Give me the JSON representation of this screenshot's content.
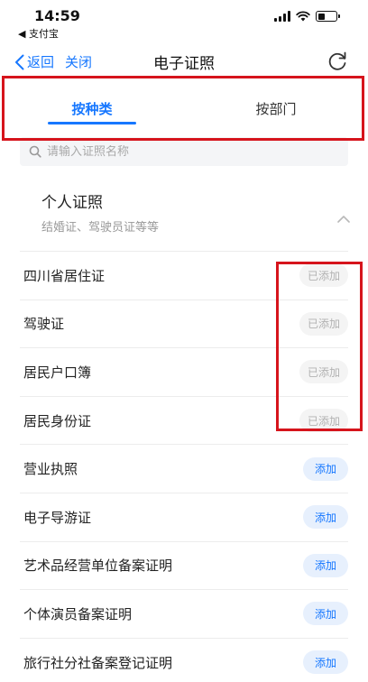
{
  "status_bar": {
    "time": "14:59",
    "back_app": "◀ 支付宝"
  },
  "nav": {
    "back_label": "返回",
    "close_label": "关闭",
    "title": "电子证照"
  },
  "tabs": [
    {
      "label": "按种类",
      "active": true
    },
    {
      "label": "按部门",
      "active": false
    }
  ],
  "search": {
    "placeholder": "请输入证照名称"
  },
  "category": {
    "title": "个人证照",
    "subtitle": "结婚证、驾驶员证等等"
  },
  "items": [
    {
      "name": "四川省居住证",
      "button": "已添加",
      "state": "added"
    },
    {
      "name": "驾驶证",
      "button": "已添加",
      "state": "added"
    },
    {
      "name": "居民户口簿",
      "button": "已添加",
      "state": "added"
    },
    {
      "name": "居民身份证",
      "button": "已添加",
      "state": "added"
    },
    {
      "name": "营业执照",
      "button": "添加",
      "state": "add"
    },
    {
      "name": "电子导游证",
      "button": "添加",
      "state": "add"
    },
    {
      "name": "艺术品经营单位备案证明",
      "button": "添加",
      "state": "add"
    },
    {
      "name": "个体演员备案证明",
      "button": "添加",
      "state": "add"
    },
    {
      "name": "旅行社分社备案登记证明",
      "button": "添加",
      "state": "add"
    }
  ],
  "colors": {
    "accent": "#1677ff",
    "annotation": "#d6141c",
    "added_text": "#b2b2b2",
    "add_bg": "#e7f0fd"
  }
}
